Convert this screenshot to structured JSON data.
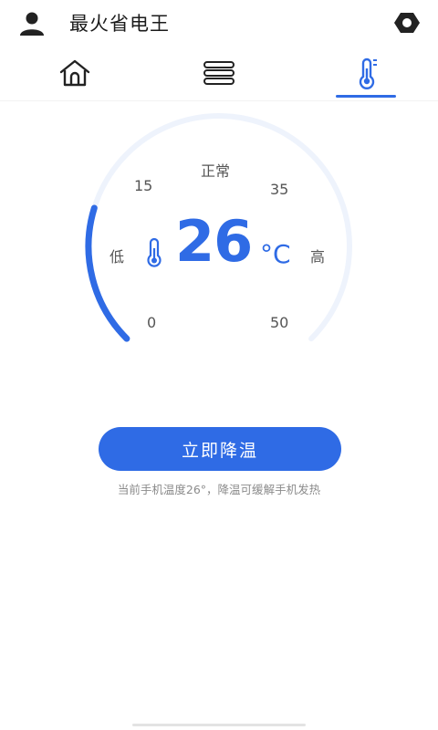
{
  "header": {
    "app_title": "最火省电王"
  },
  "icons": {
    "profile": "person-icon",
    "settings": "settings-icon",
    "home_tab": "home-icon",
    "list_tab": "list-icon",
    "temp_tab": "thermometer-icon"
  },
  "gauge": {
    "status_label": "正常",
    "min": 0,
    "max": 50,
    "value": 26,
    "unit": "°C",
    "tick_labels": {
      "t0": "0",
      "t15": "15",
      "t35": "35",
      "t50": "50"
    },
    "low_label": "低",
    "high_label": "高"
  },
  "action": {
    "button_label": "立即降温",
    "hint": "当前手机温度26°，降温可缓解手机发热"
  },
  "colors": {
    "accent": "#2f6be5",
    "track": "#eef3fc",
    "icon_dark": "#222222"
  }
}
